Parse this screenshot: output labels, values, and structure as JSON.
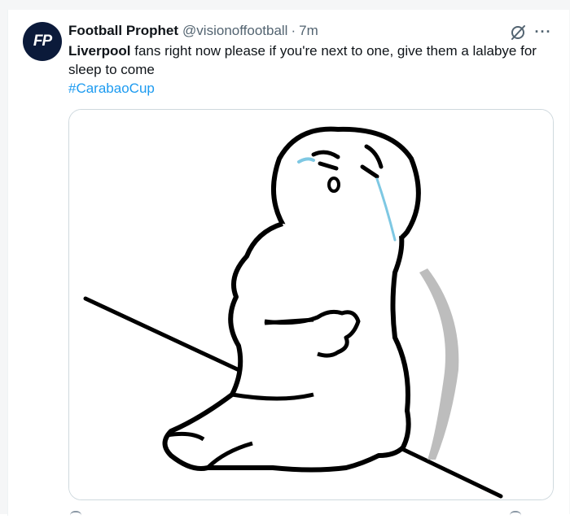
{
  "tweet": {
    "display_name": "Football Prophet",
    "handle": "@visionoffootball",
    "separator": "·",
    "time": "7m",
    "avatar_initials": "FP",
    "text_bold": "Liverpool",
    "text_rest": " fans right now please if you're next to one, give them a lalabye for sleep to come",
    "hashtag": "#CarabaoCup",
    "more_glyph": "···",
    "icons": [
      "grok-icon",
      "more-icon"
    ]
  },
  "media": {
    "description_icon": "crying-cartoon-image"
  },
  "colors": {
    "accent": "#1d9bf0",
    "text": "#0f1419",
    "muted": "#536471"
  }
}
